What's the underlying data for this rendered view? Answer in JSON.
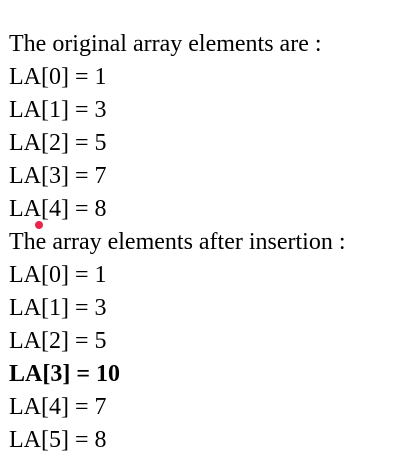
{
  "header_original": "The original array elements are :",
  "original": [
    "LA[0] = 1",
    "LA[1] = 3",
    "LA[2] = 5",
    "LA[3] = 7",
    "LA[4] = 8"
  ],
  "header_after": "The array elements after insertion :",
  "after": [
    "LA[0] = 1",
    "LA[1] = 3",
    "LA[2] = 5",
    "LA[3] = 10",
    "LA[4] = 7",
    "LA[5] = 8"
  ],
  "cursor_color": "#e8254a"
}
